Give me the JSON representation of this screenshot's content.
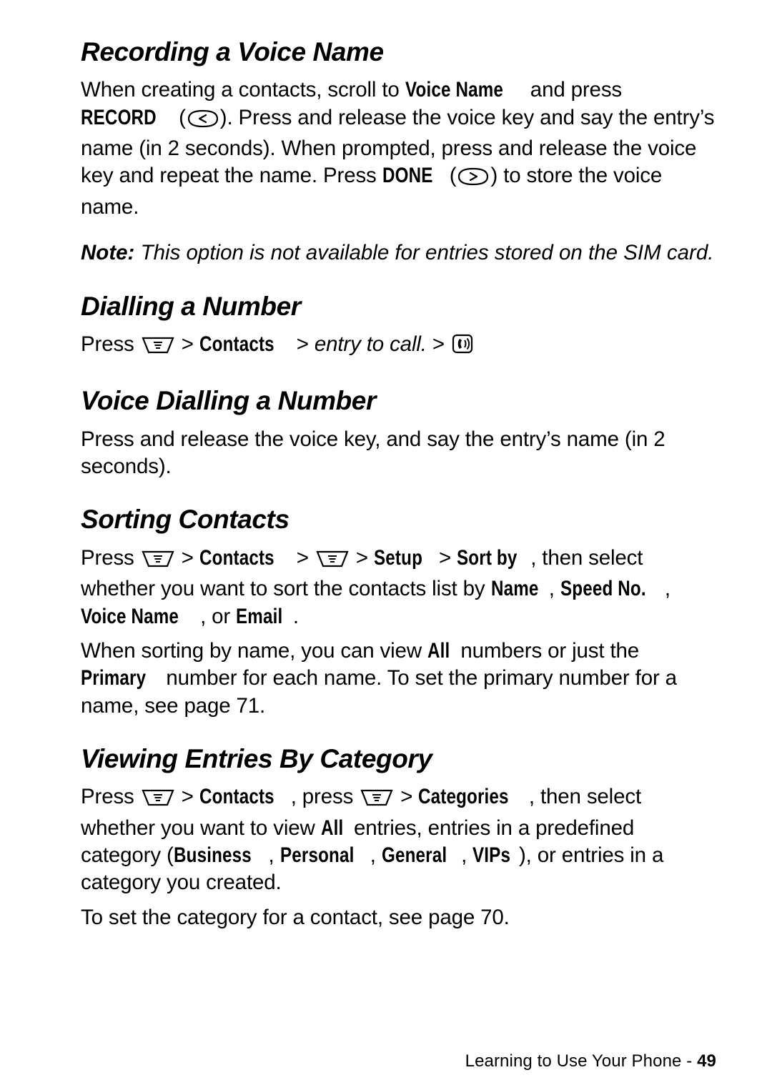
{
  "page": {
    "footer_text": "Learning to Use Your Phone - ",
    "footer_number": "49"
  },
  "sections": [
    {
      "id": "recording-a-voice-name",
      "title": "Recording a Voice Name",
      "paragraphs": [
        {
          "id": "recording-intro",
          "parts": [
            {
              "type": "text",
              "value": "When creating a contacts, scroll to "
            },
            {
              "type": "ui",
              "value": "Voice Name"
            },
            {
              "type": "text",
              "value": " and press "
            },
            {
              "type": "ui",
              "value": "RECORD"
            },
            {
              "type": "text",
              "value": " ("
            },
            {
              "type": "icon",
              "value": "softkey-left-icon"
            },
            {
              "type": "text",
              "value": "). Press and release the voice key and say the entry’s name (in 2 seconds). When prompted, press and release the voice key and repeat the name. Press "
            },
            {
              "type": "ui",
              "value": "DONE"
            },
            {
              "type": "text",
              "value": " ("
            },
            {
              "type": "icon",
              "value": "softkey-right-icon"
            },
            {
              "type": "text",
              "value": ") to store the voice name."
            }
          ]
        }
      ],
      "note": {
        "label": "Note:",
        "text": " This option is not available for entries stored on the SIM card."
      }
    },
    {
      "id": "dialling-a-number",
      "title": "Dialling a Number",
      "paragraphs": [
        {
          "id": "dialling-press",
          "parts": [
            {
              "type": "text",
              "value": "Press "
            },
            {
              "type": "icon",
              "value": "menu-key-icon"
            },
            {
              "type": "text",
              "value": " > "
            },
            {
              "type": "ui",
              "value": "Contacts"
            },
            {
              "type": "text",
              "value": " > "
            },
            {
              "type": "italic",
              "value": "entry to call."
            },
            {
              "type": "text",
              "value": " > "
            },
            {
              "type": "icon",
              "value": "send-key-icon"
            }
          ]
        }
      ]
    },
    {
      "id": "voice-dialling-a-number",
      "title": "Voice Dialling a Number",
      "paragraphs": [
        {
          "id": "voice-dialling-body",
          "parts": [
            {
              "type": "text",
              "value": "Press and release the voice key, and say the entry’s name (in 2 seconds)."
            }
          ]
        }
      ]
    },
    {
      "id": "sorting-contacts",
      "title": "Sorting Contacts",
      "paragraphs": [
        {
          "id": "sorting-press",
          "parts": [
            {
              "type": "text",
              "value": "Press "
            },
            {
              "type": "icon",
              "value": "menu-key-icon"
            },
            {
              "type": "text",
              "value": " > "
            },
            {
              "type": "ui",
              "value": "Contacts"
            },
            {
              "type": "text",
              "value": " > "
            },
            {
              "type": "icon",
              "value": "menu-key-icon"
            },
            {
              "type": "text",
              "value": " > "
            },
            {
              "type": "ui",
              "value": "Setup"
            },
            {
              "type": "text",
              "value": " > "
            },
            {
              "type": "ui",
              "value": "Sort by"
            },
            {
              "type": "text",
              "value": ", then select whether you want to sort the contacts list by "
            },
            {
              "type": "ui",
              "value": "Name"
            },
            {
              "type": "text",
              "value": ", "
            },
            {
              "type": "ui",
              "value": "Speed No."
            },
            {
              "type": "text",
              "value": ", "
            },
            {
              "type": "ui",
              "value": "Voice Name"
            },
            {
              "type": "text",
              "value": ", or "
            },
            {
              "type": "ui",
              "value": "Email"
            },
            {
              "type": "text",
              "value": "."
            }
          ]
        },
        {
          "id": "sorting-primary",
          "parts": [
            {
              "type": "text",
              "value": "When sorting by name, you can view "
            },
            {
              "type": "ui",
              "value": "All"
            },
            {
              "type": "text",
              "value": " numbers or just the "
            },
            {
              "type": "ui",
              "value": "Primary"
            },
            {
              "type": "text",
              "value": " number for each name. To set the primary number for a name, see page 71."
            }
          ]
        }
      ]
    },
    {
      "id": "viewing-entries-by-category",
      "title": "Viewing Entries By Category",
      "paragraphs": [
        {
          "id": "viewing-press",
          "parts": [
            {
              "type": "text",
              "value": "Press "
            },
            {
              "type": "icon",
              "value": "menu-key-icon"
            },
            {
              "type": "text",
              "value": " > "
            },
            {
              "type": "ui",
              "value": "Contacts"
            },
            {
              "type": "text",
              "value": ", press "
            },
            {
              "type": "icon",
              "value": "menu-key-icon"
            },
            {
              "type": "text",
              "value": " > "
            },
            {
              "type": "ui",
              "value": "Categories"
            },
            {
              "type": "text",
              "value": ", then select whether you want to view "
            },
            {
              "type": "ui",
              "value": "All"
            },
            {
              "type": "text",
              "value": " entries, entries in a predefined category ("
            },
            {
              "type": "ui",
              "value": "Business"
            },
            {
              "type": "text",
              "value": ", "
            },
            {
              "type": "ui",
              "value": "Personal"
            },
            {
              "type": "text",
              "value": ", "
            },
            {
              "type": "ui",
              "value": "General"
            },
            {
              "type": "text",
              "value": ", "
            },
            {
              "type": "ui",
              "value": "VIPs"
            },
            {
              "type": "text",
              "value": "), or entries in a category you created."
            }
          ]
        },
        {
          "id": "viewing-category-set",
          "parts": [
            {
              "type": "text",
              "value": "To set the category for a contact, see page 70."
            }
          ]
        }
      ]
    }
  ]
}
